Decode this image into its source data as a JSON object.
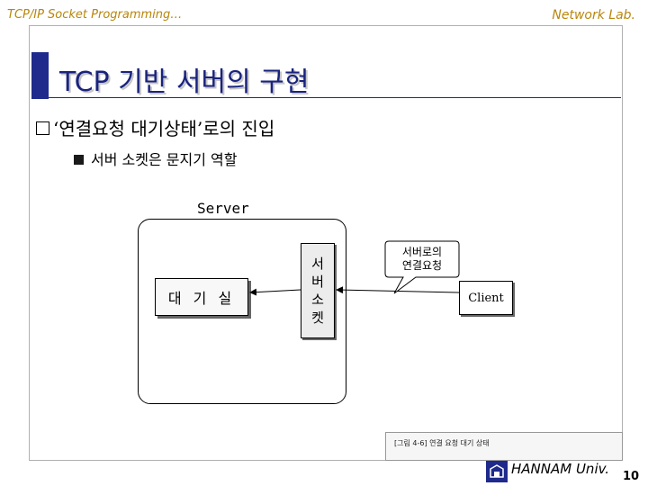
{
  "header": {
    "course": "TCP/IP Socket Programming…",
    "lab": "Network Lab."
  },
  "title": "TCP 기반 서버의 구현",
  "bullet1": "‘연결요청 대기상태’로의 진입",
  "bullet2": "서버 소켓은 문지기 역할",
  "diagram": {
    "server_label": "Server",
    "waiting_room": "대 기 실",
    "server_socket_chars": [
      "서",
      "버",
      "소",
      "켓"
    ],
    "client": "Client",
    "callout_lines": [
      "서버로의",
      "연결요청"
    ]
  },
  "caption": "[그림 4-6] 연결 요청 대기 상태",
  "footer": {
    "university": "HANNAM Univ.",
    "page": "10"
  },
  "colors": {
    "header_text": "#b8860b",
    "title_text": "#1a237e",
    "accent": "#1f2a8c"
  }
}
